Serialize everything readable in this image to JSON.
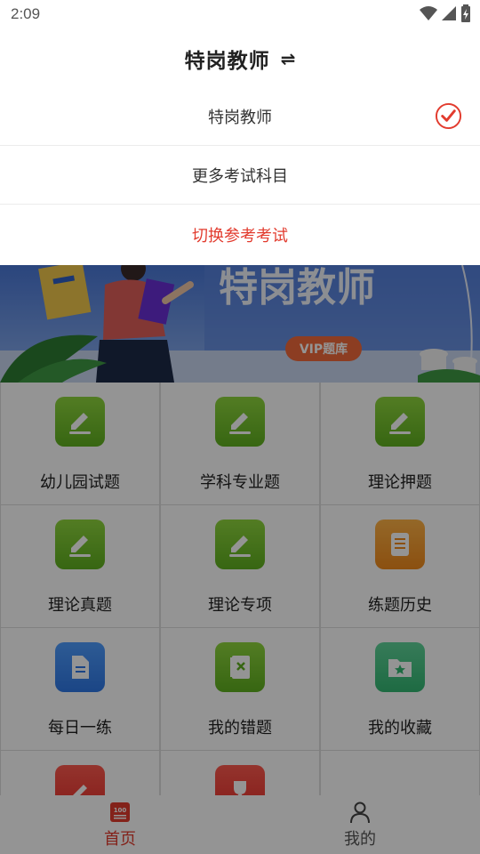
{
  "status_bar": {
    "time": "2:09"
  },
  "header": {
    "title": "特岗教师"
  },
  "dropdown": {
    "items": [
      {
        "label": "特岗教师",
        "selected": true
      },
      {
        "label": "更多考试科目",
        "selected": false
      },
      {
        "label": "切换参考考试",
        "selected": false,
        "accent": true
      }
    ]
  },
  "banner": {
    "title": "特岗教师",
    "badge": "VIP题库"
  },
  "grid": {
    "items": [
      {
        "label": "幼儿园试题",
        "icon": "edit-icon",
        "color": "#6cc12a"
      },
      {
        "label": "学科专业题",
        "icon": "edit-icon",
        "color": "#6cc12a"
      },
      {
        "label": "理论押题",
        "icon": "edit-icon",
        "color": "#6cc12a"
      },
      {
        "label": "理论真题",
        "icon": "edit-icon",
        "color": "#6cc12a"
      },
      {
        "label": "理论专项",
        "icon": "edit-icon",
        "color": "#6cc12a"
      },
      {
        "label": "练题历史",
        "icon": "list-icon",
        "color": "#f5961e"
      },
      {
        "label": "每日一练",
        "icon": "document-icon",
        "color": "#3b84ef"
      },
      {
        "label": "我的错题",
        "icon": "wrong-book-icon",
        "color": "#6cc12a"
      },
      {
        "label": "我的收藏",
        "icon": "folder-star-icon",
        "color": "#3fc282"
      },
      {
        "label": "",
        "icon": "pencil-icon",
        "color": "#e6302a"
      },
      {
        "label": "",
        "icon": "trophy-icon",
        "color": "#e6302a"
      }
    ]
  },
  "bottom_nav": {
    "items": [
      {
        "label": "首页",
        "icon": "home-100-icon",
        "active": true
      },
      {
        "label": "我的",
        "icon": "person-icon",
        "active": false
      }
    ]
  },
  "colors": {
    "accent": "#e23b2e",
    "green": "#6cc12a"
  }
}
